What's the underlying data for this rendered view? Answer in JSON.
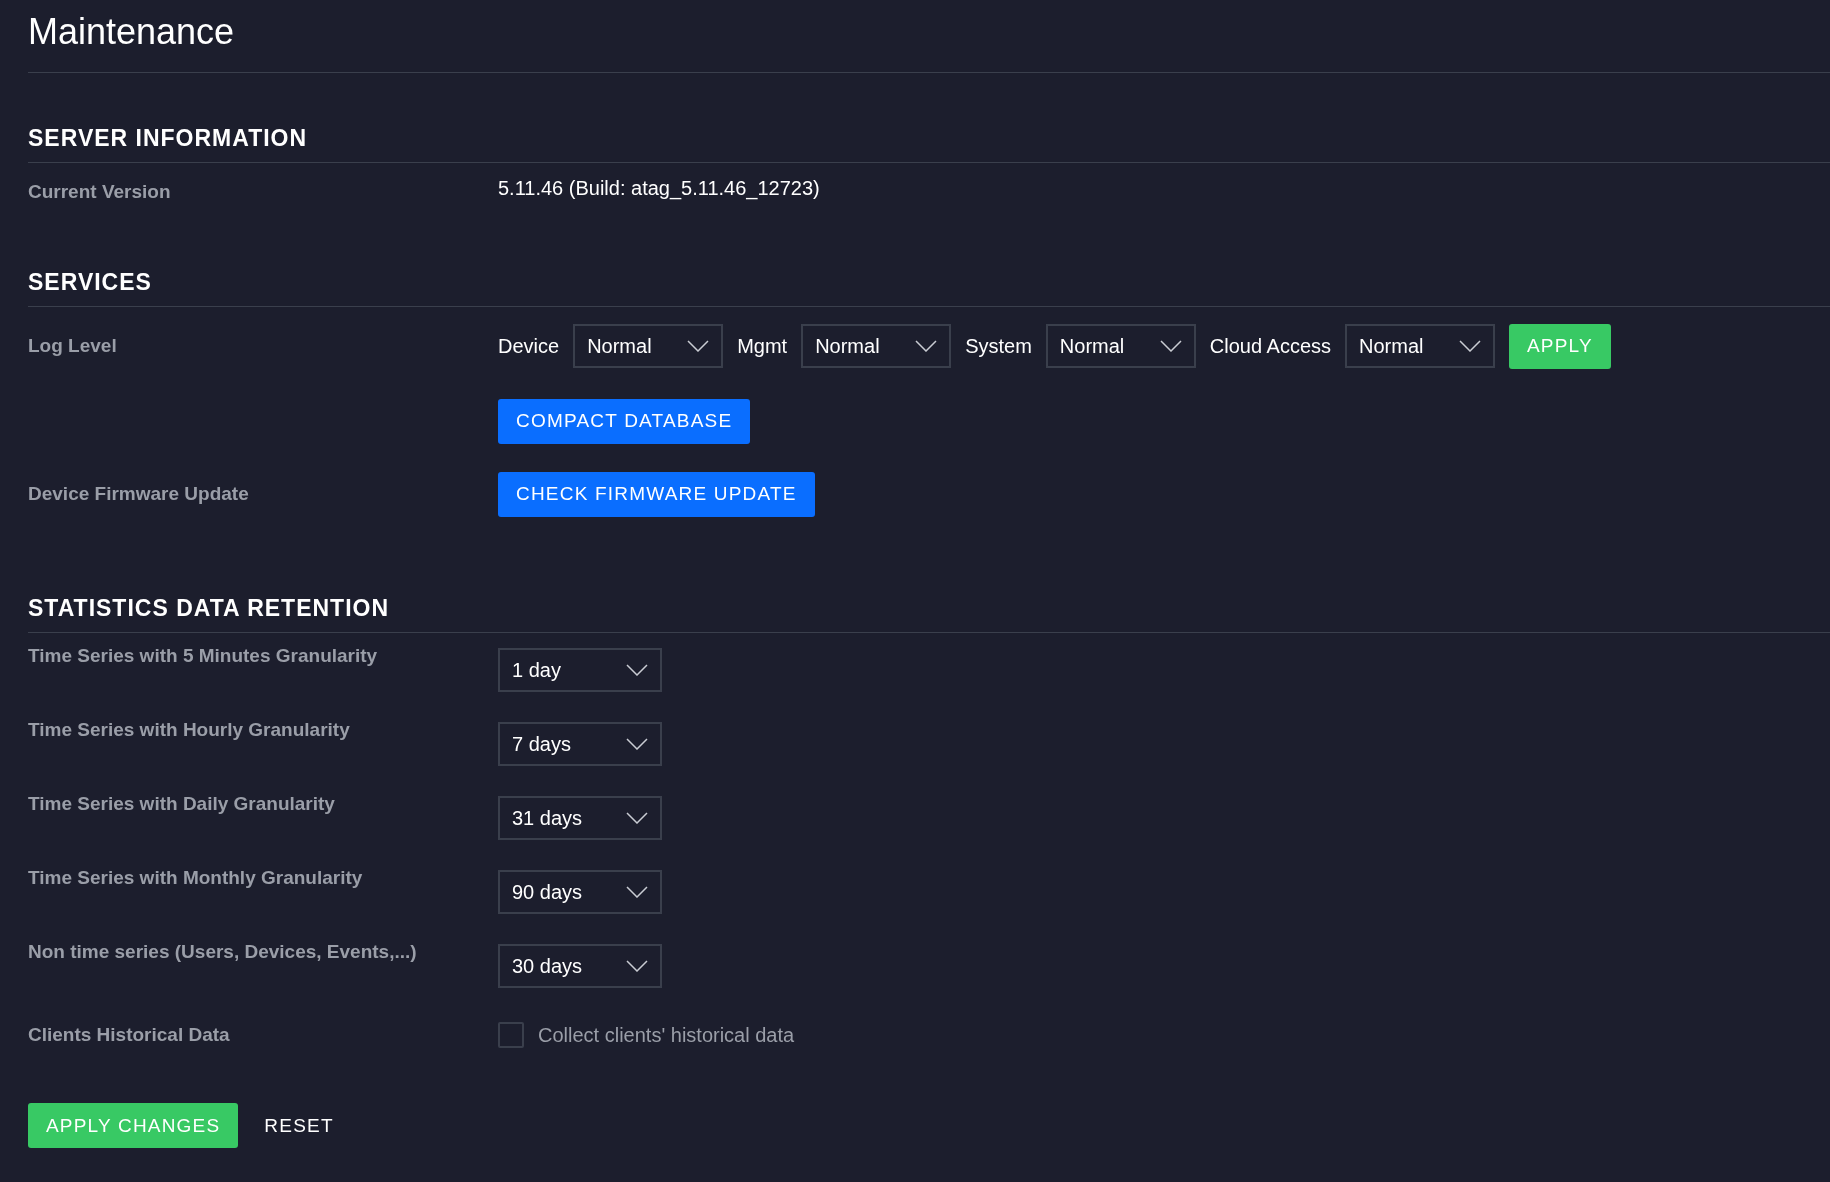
{
  "page": {
    "title": "Maintenance"
  },
  "sections": [
    {
      "heading": "SERVER INFORMATION",
      "rows": [
        {
          "kind": "text",
          "label": "Current Version",
          "value": "5.11.46 (Build: atag_5.11.46_12723)"
        }
      ]
    },
    {
      "heading": "SERVICES",
      "rows": [
        {
          "kind": "log_levels",
          "label": "Log Level",
          "levels": [
            {
              "label": "Device",
              "value": "Normal"
            },
            {
              "label": "Mgmt",
              "value": "Normal"
            },
            {
              "label": "System",
              "value": "Normal"
            },
            {
              "label": "Cloud Access",
              "value": "Normal"
            }
          ],
          "button": "APPLY"
        },
        {
          "kind": "button",
          "button": "COMPACT DATABASE"
        },
        {
          "kind": "button",
          "label": "Device Firmware Update",
          "button": "CHECK FIRMWARE UPDATE"
        }
      ]
    },
    {
      "heading": "STATISTICS DATA RETENTION",
      "rows": [
        {
          "kind": "select",
          "label": "Time Series with 5 Minutes Granularity",
          "value": "1 day"
        },
        {
          "kind": "select",
          "label": "Time Series with Hourly Granularity",
          "value": "7 days"
        },
        {
          "kind": "select",
          "label": "Time Series with Daily Granularity",
          "value": "31 days"
        },
        {
          "kind": "select",
          "label": "Time Series with Monthly Granularity",
          "value": "90 days"
        },
        {
          "kind": "select",
          "label": "Non time series (Users, Devices, Events,...)",
          "value": "30 days"
        },
        {
          "kind": "checkbox",
          "label": "Clients Historical Data",
          "text": "Collect clients' historical data",
          "checked": false
        }
      ]
    }
  ],
  "actions": [
    {
      "kind": "primary",
      "label": "APPLY CHANGES"
    },
    {
      "kind": "plain",
      "label": "RESET"
    }
  ]
}
